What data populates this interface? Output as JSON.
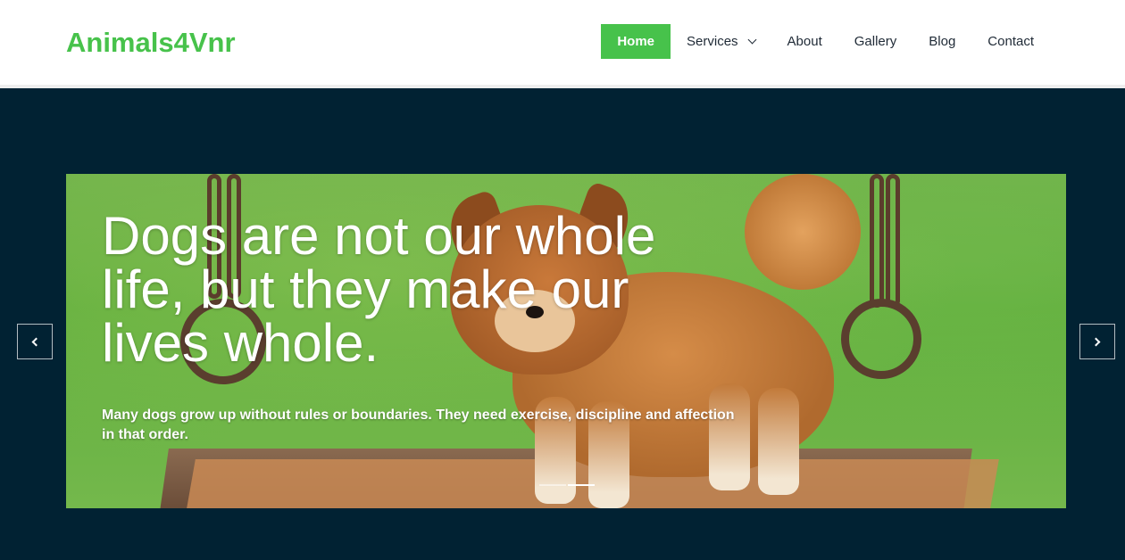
{
  "header": {
    "logo": "Animals4Vnr",
    "nav": [
      {
        "label": "Home",
        "active": true
      },
      {
        "label": "Services",
        "has_dropdown": true
      },
      {
        "label": "About"
      },
      {
        "label": "Gallery"
      },
      {
        "label": "Blog"
      },
      {
        "label": "Contact"
      }
    ]
  },
  "hero": {
    "title": "Dogs are not our whole life, but they make our lives whole.",
    "text": "Many dogs grow up without rules or boundaries. They need exercise, discipline and affection in that order.",
    "image": "puppy-on-swing",
    "indicators": {
      "count": 2,
      "active_index": 1
    }
  },
  "colors": {
    "brand": "#47c24b",
    "hero_bg": "#012233",
    "nav_text": "#1f2a36"
  },
  "icons": {
    "prev": "chevron-left-icon",
    "next": "chevron-right-icon",
    "dropdown": "chevron-down-icon"
  }
}
